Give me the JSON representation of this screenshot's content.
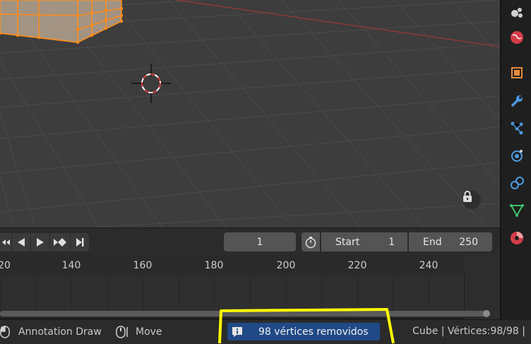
{
  "viewport": {
    "lock_icon": "lock-icon",
    "cursor_icon": "3d-cursor-icon",
    "colors": {
      "background": "#3d3d3d",
      "grid": "#4a4a4a",
      "x_axis": "#8b3a3a",
      "selection": "#ff8c1a"
    }
  },
  "properties_tabs": [
    {
      "name": "scene",
      "icon": "scene-icon"
    },
    {
      "name": "world",
      "icon": "world-icon"
    },
    {
      "name": "object",
      "icon": "object-icon"
    },
    {
      "name": "modifiers",
      "icon": "wrench-icon"
    },
    {
      "name": "particles",
      "icon": "particles-icon"
    },
    {
      "name": "physics",
      "icon": "physics-icon"
    },
    {
      "name": "constraints",
      "icon": "constraints-icon"
    },
    {
      "name": "data",
      "icon": "mesh-data-icon"
    },
    {
      "name": "material",
      "icon": "material-icon"
    }
  ],
  "timeline": {
    "current_frame": "1",
    "start_label": "Start",
    "start_value": "1",
    "end_label": "End",
    "end_value": "250",
    "ticks": [
      "20",
      "140",
      "160",
      "180",
      "200",
      "220",
      "240"
    ]
  },
  "statusbar": {
    "annotation_label": "Annotation Draw",
    "move_label": "Move",
    "notification": "98 vértices removidos",
    "stats": "Cube | Vértices:98/98 |",
    "colors": {
      "notification_bg": "#204a87",
      "highlight": "#ffff00"
    }
  }
}
